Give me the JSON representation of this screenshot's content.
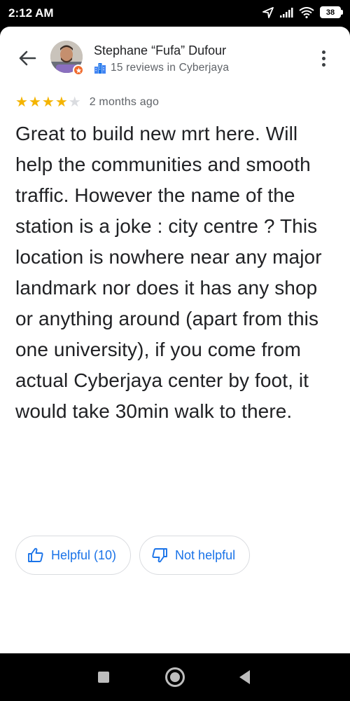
{
  "status_bar": {
    "time": "2:12 AM",
    "battery": "38",
    "icons": [
      "location-arrow-icon",
      "signal-icon",
      "wifi-icon",
      "battery-icon"
    ]
  },
  "reviewer": {
    "name": "Stephane “Fufa” Dufour",
    "meta": "15 reviews in Cyberjaya",
    "meta_icon": "city-icon",
    "badge_icon": "local-guide-icon"
  },
  "review": {
    "rating": 4,
    "max_rating": 5,
    "time_ago": "2 months ago",
    "text": "Great to build new mrt here. Will help the  communities and smooth traffic. However the name of the station is a joke : city centre ? This location is nowhere near any major landmark nor does it has any shop or anything around (apart from this one university), if you come from actual Cyberjaya center by foot, it would take 30min walk to there."
  },
  "actions": {
    "helpful_label": "Helpful (10)",
    "not_helpful_label": "Not helpful"
  },
  "colors": {
    "accent": "#1a73e8",
    "star": "#f4b400",
    "star_empty": "#dadce0",
    "badge": "#f06a2c"
  }
}
